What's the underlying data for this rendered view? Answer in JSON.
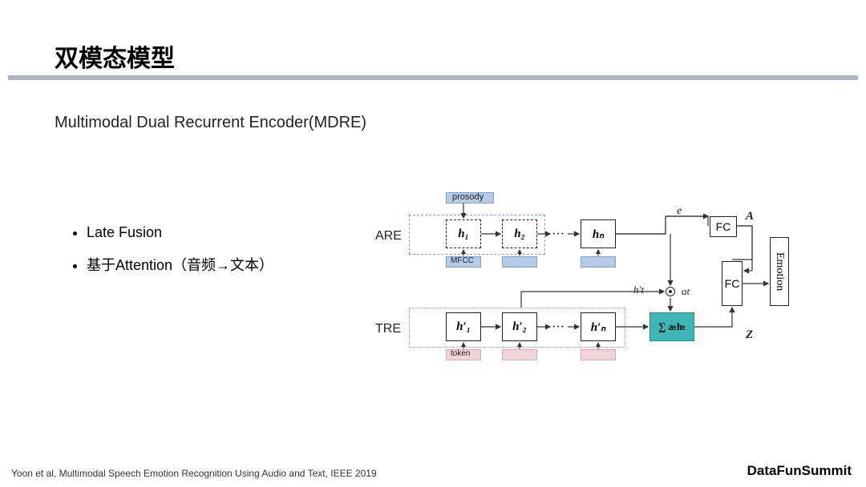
{
  "title": "双模态模型",
  "subtitle": "Multimodal Dual Recurrent Encoder(MDRE)",
  "bullets": [
    "Late Fusion",
    "基于Attention（音频→文本）"
  ],
  "citation": "Yoon et al, Multimodal Speech Emotion Recognition Using Audio and Text, IEEE 2019",
  "brand": "DataFunSummit",
  "diagram": {
    "row_labels": {
      "are": "ARE",
      "tre": "TRE"
    },
    "top_bar": "prosody",
    "are_nodes": [
      "h₁",
      "h₂",
      "hₙ"
    ],
    "are_bar": "MFCC",
    "tre_nodes": [
      "h′₁",
      "h′₂",
      "h′ₙ"
    ],
    "tre_bar": "token",
    "dots": "···",
    "edge_e": "e",
    "edge_ht": "h′t",
    "edge_at": "at",
    "fc": "FC",
    "fc2": "FC",
    "A": "A",
    "Z": "Z",
    "sum": "∑ aₜhₜ",
    "emotion": "Emotion"
  }
}
